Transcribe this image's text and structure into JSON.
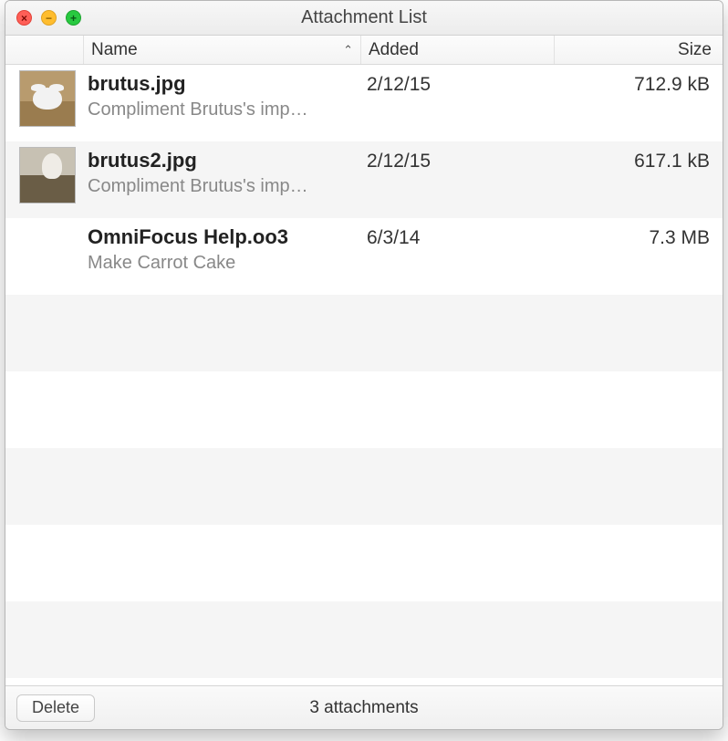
{
  "window": {
    "title": "Attachment List"
  },
  "columns": {
    "name": "Name",
    "added": "Added",
    "size": "Size",
    "sort_indicator": "⌃"
  },
  "attachments": [
    {
      "filename": "brutus.jpg",
      "description": "Compliment Brutus's imp…",
      "added": "2/12/15",
      "size": "712.9 kB",
      "thumb_class": "cat1"
    },
    {
      "filename": "brutus2.jpg",
      "description": "Compliment Brutus's imp…",
      "added": "2/12/15",
      "size": "617.1 kB",
      "thumb_class": "cat2"
    },
    {
      "filename": "OmniFocus Help.oo3",
      "description": "Make Carrot Cake",
      "added": "6/3/14",
      "size": "7.3 MB",
      "thumb_class": ""
    }
  ],
  "footer": {
    "delete_label": "Delete",
    "status": "3 attachments"
  },
  "traffic_lights": {
    "close": "×",
    "minimize": "−",
    "maximize": "+"
  }
}
